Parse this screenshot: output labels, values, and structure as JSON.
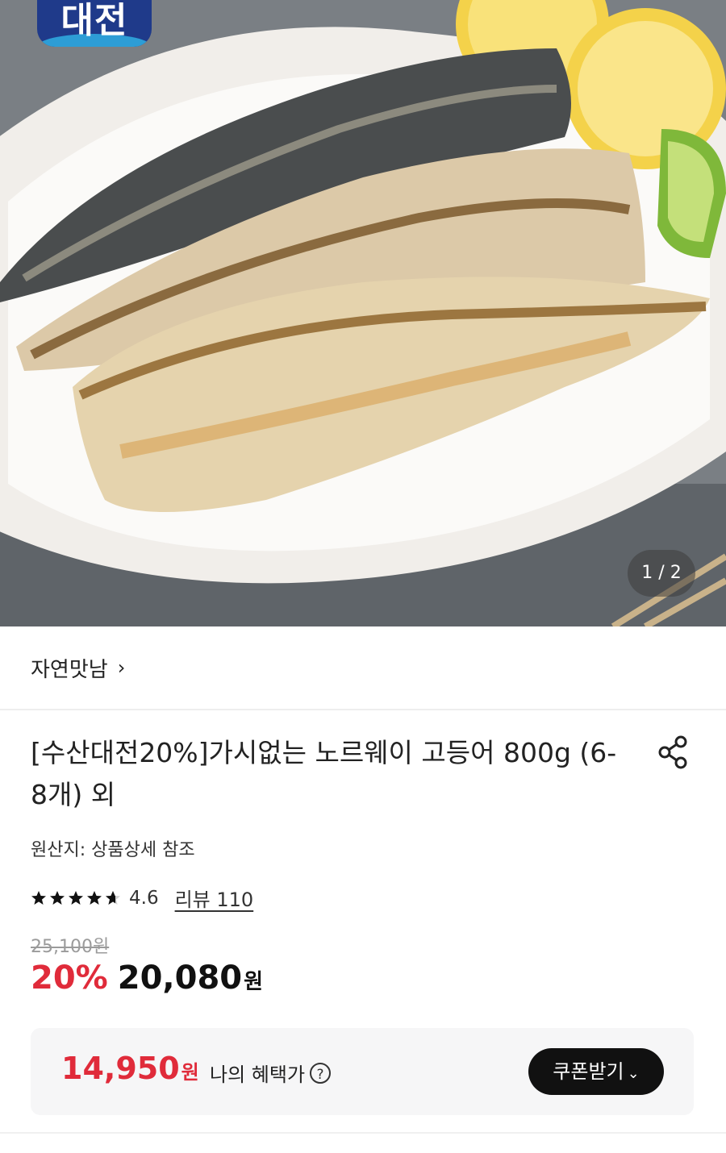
{
  "hero": {
    "badge_text": "대전",
    "image_counter": "1 / 2",
    "image_description": "grilled boneless mackerel fillets on white plate with lemon and lime"
  },
  "brand": {
    "name": "자연맛남",
    "chevron": "›"
  },
  "product": {
    "title": "[수산대전20%]가시없는 노르웨이 고등어 800g (6-8개) 외",
    "origin": "원산지: 상품상세 참조",
    "rating": "4.6",
    "stars_filled": 4.6,
    "review_link": "리뷰 110",
    "original_price": "25,100원",
    "discount_rate": "20%",
    "sale_price": "20,080",
    "sale_currency": "원"
  },
  "benefit": {
    "price": "14,950",
    "currency": "원",
    "label": "나의 혜택가",
    "help_icon": "?",
    "coupon_button": "쿠폰받기",
    "coupon_chevron": "⌄"
  },
  "colors": {
    "accent_red": "#e02b3a",
    "badge_blue": "#1f3a8a",
    "button_black": "#111111"
  },
  "icons": [
    "share-icon",
    "star-icon",
    "question-circle-icon",
    "chevron-down-icon",
    "chevron-right-icon"
  ]
}
